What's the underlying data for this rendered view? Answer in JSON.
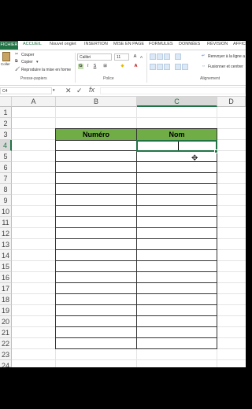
{
  "ribbon": {
    "tabs": [
      "FICHIER",
      "ACCUEIL",
      "Nouvel onglet",
      "INSERTION",
      "MISE EN PAGE",
      "FORMULES",
      "DONNÉES",
      "RÉVISION",
      "AFFIC"
    ],
    "clipboard": {
      "paste": "Coller",
      "cut": "Couper",
      "copy": "Copier",
      "format_painter": "Reproduire la mise en forme",
      "group": "Presse-papiers"
    },
    "font": {
      "name": "Calibri",
      "size": "11",
      "bold": "G",
      "italic": "I",
      "underline": "S",
      "group": "Police"
    },
    "alignment": {
      "wrap": "Renvoyer à la ligne a",
      "merge": "Fusionner et centrer",
      "group": "Alignement"
    }
  },
  "formula_bar": {
    "name_box": "C4",
    "cancel": "✕",
    "enter": "✓",
    "fx": "fx",
    "value": ""
  },
  "sheet": {
    "columns": [
      "A",
      "B",
      "C",
      "D"
    ],
    "selected_column": "C",
    "rows": [
      "1",
      "2",
      "3",
      "4",
      "5",
      "6",
      "7",
      "8",
      "9",
      "10",
      "11",
      "12",
      "13",
      "14",
      "15",
      "16",
      "17",
      "18",
      "19",
      "20",
      "21",
      "22",
      "23",
      "24"
    ],
    "selected_row": "4",
    "table_headers": [
      "Numéro",
      "Nom"
    ],
    "active_cell": "C4"
  },
  "colors": {
    "brand": "#217346",
    "table_header": "#70ad47"
  }
}
